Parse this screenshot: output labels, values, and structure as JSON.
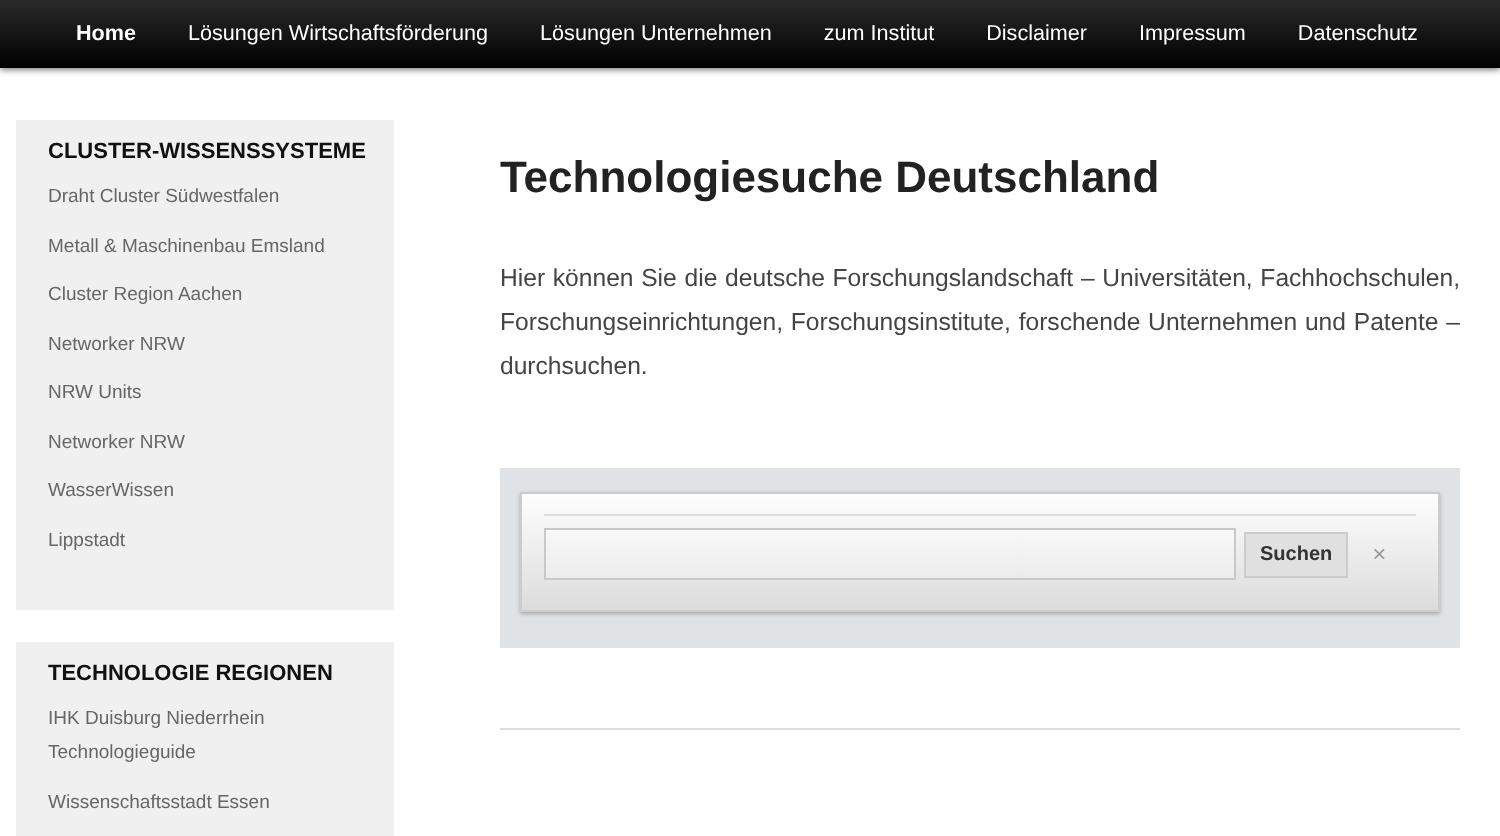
{
  "nav": [
    {
      "label": "Home",
      "selected": true
    },
    {
      "label": "Lösungen Wirtschaftsförderung",
      "selected": false
    },
    {
      "label": "Lösungen Unternehmen",
      "selected": false
    },
    {
      "label": "zum Institut",
      "selected": false
    },
    {
      "label": "Disclaimer",
      "selected": false
    },
    {
      "label": "Impressum",
      "selected": false
    },
    {
      "label": "Datenschutz",
      "selected": false
    }
  ],
  "sidebar": [
    {
      "title": "CLUSTER-WISSENSSYSTEME",
      "items": [
        "Draht Cluster Südwestfalen",
        "Metall & Maschinenbau Emsland",
        "Cluster Region Aachen",
        "Networker NRW",
        "NRW Units",
        "Networker NRW",
        "WasserWissen",
        "Lippstadt"
      ]
    },
    {
      "title": "TECHNOLOGIE REGIONEN",
      "items": [
        "IHK Duisburg Niederrhein Technologieguide",
        "Wissenschaftsstadt Essen"
      ]
    }
  ],
  "main": {
    "heading": "Technologiesuche Deutschland",
    "intro": "Hier können Sie die deutsche Forschungslandschaft – Universitäten, Fachhochschulen, Forschungseinrichtungen, Forschungsinstitute, forschende Unternehmen und Patente – durchsuchen.",
    "search": {
      "button": "Suchen",
      "clear": "×"
    }
  }
}
